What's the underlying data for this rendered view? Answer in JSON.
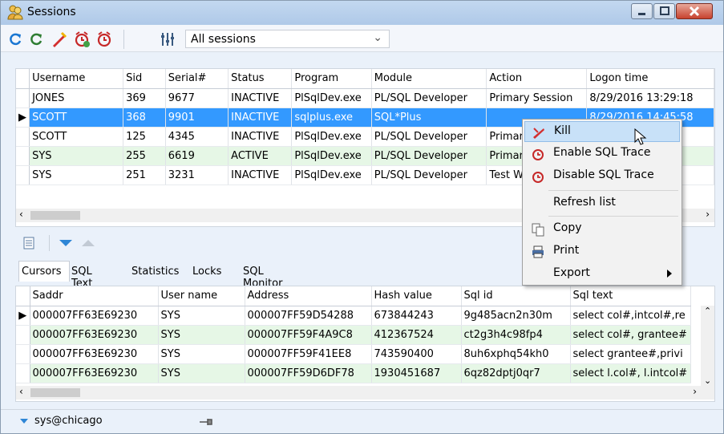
{
  "window": {
    "title": "Sessions"
  },
  "toolbar": {
    "session_filter": "All sessions"
  },
  "sessions": {
    "columns": [
      "Username",
      "Sid",
      "Serial#",
      "Status",
      "Program",
      "Module",
      "Action",
      "Logon time"
    ],
    "rows": [
      [
        "JONES",
        "369",
        "9677",
        "INACTIVE",
        "PlSqlDev.exe",
        "PL/SQL Developer",
        "Primary Session",
        "8/29/2016 13:29:18"
      ],
      [
        "SCOTT",
        "368",
        "9901",
        "INACTIVE",
        "sqlplus.exe",
        "SQL*Plus",
        "",
        "8/29/2016 14:45:58"
      ],
      [
        "SCOTT",
        "125",
        "4345",
        "INACTIVE",
        "PlSqlDev.exe",
        "PL/SQL Developer",
        "Primar",
        ":37"
      ],
      [
        "SYS",
        "255",
        "6619",
        "ACTIVE",
        "PlSqlDev.exe",
        "PL/SQL Developer",
        "Primar",
        "3:47"
      ],
      [
        "SYS",
        "251",
        "3231",
        "INACTIVE",
        "PlSqlDev.exe",
        "PL/SQL Developer",
        "Test W",
        "4:27"
      ]
    ]
  },
  "context_menu": {
    "kill": "Kill",
    "enable_trace": "Enable SQL Trace",
    "disable_trace": "Disable SQL Trace",
    "refresh": "Refresh list",
    "copy": "Copy",
    "print": "Print",
    "export": "Export"
  },
  "detail_tabs": [
    "Cursors",
    "SQL Text",
    "Statistics",
    "Locks",
    "SQL Monitor"
  ],
  "cursors": {
    "columns": [
      "Saddr",
      "User name",
      "Address",
      "Hash value",
      "Sql id",
      "Sql text"
    ],
    "rows": [
      [
        "000007FF63E69230",
        "SYS",
        "000007FF59D54288",
        "673844243",
        "9g485acn2n30m",
        "select col#,intcol#,re"
      ],
      [
        "000007FF63E69230",
        "SYS",
        "000007FF59F4A9C8",
        "412367524",
        "ct2g3h4c98fp4",
        "select col#, grantee#"
      ],
      [
        "000007FF63E69230",
        "SYS",
        "000007FF59F41EE8",
        "743590400",
        "8uh6xphq54kh0",
        "select grantee#,privi"
      ],
      [
        "000007FF63E69230",
        "SYS",
        "000007FF59D6DF78",
        "1930451687",
        "6qz82dptj0qr7",
        "select l.col#, l.intcol#"
      ]
    ]
  },
  "status": {
    "connection": "sys@chicago"
  },
  "colors": {
    "selection": "#3399ff",
    "green_row": "#e6f7e6",
    "menu_highlight": "#c8e1f8"
  }
}
